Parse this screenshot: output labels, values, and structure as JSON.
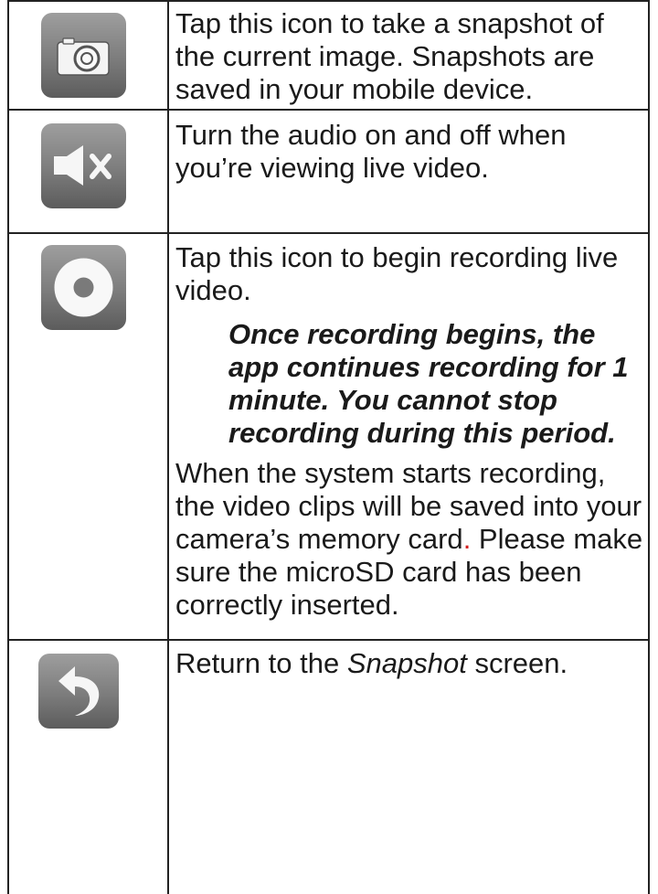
{
  "rows": [
    {
      "icon": "camera-icon",
      "text": "Tap this icon to take a snapshot of the current image. Snapshots are saved in your mobile device."
    },
    {
      "icon": "mute-icon",
      "text": "Turn the audio on and off when you’re viewing live video."
    },
    {
      "icon": "record-icon",
      "text": "Tap this icon to begin recording live video.",
      "note": "Once recording begins, the app continues recording for 1 minute. You cannot stop recording during this period.",
      "text2_part1": "When the system starts recording, the video clips will be saved into your camera’s memory card",
      "text2_period": ".",
      "text2_part2": " Please make sure the microSD card has been correctly inserted."
    },
    {
      "icon": "back-icon",
      "text_before": "Return to the ",
      "text_italic": "Snapshot",
      "text_after": " screen."
    }
  ],
  "colors": {
    "border": "#222222",
    "icon_bg": "#8a8a8a",
    "accent_red": "#d42020"
  }
}
